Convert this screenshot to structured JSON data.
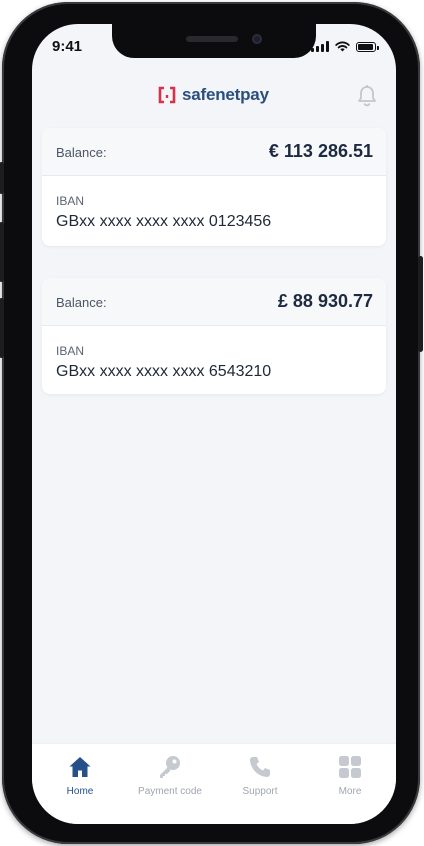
{
  "status_bar": {
    "time": "9:41"
  },
  "header": {
    "logo_text": "safenetpay",
    "brand_color": "#2a4f7c",
    "logo_mark_color": "#d6324a",
    "notification_icon": "bell-icon"
  },
  "accounts": [
    {
      "balance_label": "Balance:",
      "balance": "€ 113 286.51",
      "iban_label": "IBAN",
      "iban": "GBxx xxxx xxxx xxxx 0123456"
    },
    {
      "balance_label": "Balance:",
      "balance": "£ 88 930.77",
      "iban_label": "IBAN",
      "iban": "GBxx xxxx xxxx xxxx 6543210"
    }
  ],
  "tabbar": {
    "active_color": "#25508a",
    "inactive_color": "#a0a6b0",
    "tabs": [
      {
        "label": "Home",
        "icon": "home-icon",
        "active": true
      },
      {
        "label": "Payment code",
        "icon": "key-icon",
        "active": false
      },
      {
        "label": "Support",
        "icon": "phone-icon",
        "active": false
      },
      {
        "label": "More",
        "icon": "grid-icon",
        "active": false
      }
    ]
  }
}
